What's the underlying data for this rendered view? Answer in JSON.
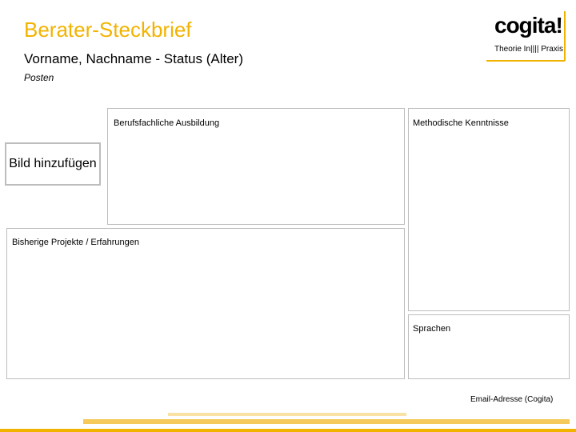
{
  "header": {
    "title": "Berater-Steckbrief",
    "subtitle": "Vorname, Nachname - Status (Alter)",
    "posten": "Posten"
  },
  "logo": {
    "wordmark": "cogita!",
    "tagline": "Theorie In|||| Praxis"
  },
  "sections": {
    "ausbildung_label": "Berufsfachliche Ausbildung",
    "kenntnisse_label": "Methodische Kenntnisse",
    "projekte_label": "Bisherige Projekte / Erfahrungen",
    "sprachen_label": "Sprachen"
  },
  "bild_button": "Bild hinzufügen",
  "footer": {
    "email": "Email-Adresse (Cogita)"
  },
  "colors": {
    "accent": "#f2b300",
    "accent_light": "#f5c95a",
    "border": "#bdbdbd"
  }
}
